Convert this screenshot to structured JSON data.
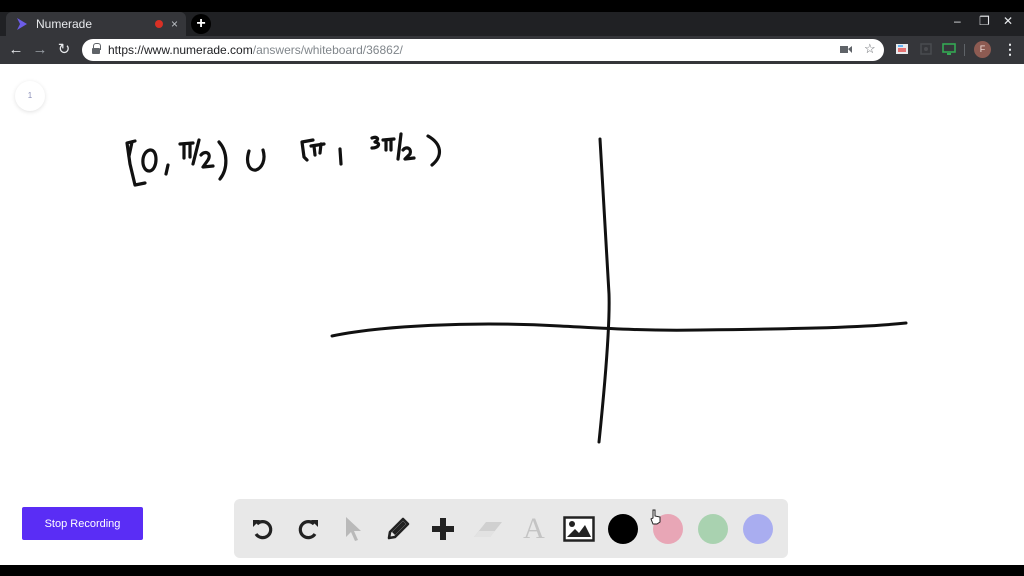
{
  "browser": {
    "tab": {
      "title": "Numerade",
      "favicon": "numerade-play-icon",
      "recording_indicator": "recording-dot-icon",
      "close": "×"
    },
    "new_tab": "+",
    "window_controls": {
      "minimize": "–",
      "restore": "❐",
      "close": "✕"
    },
    "nav": {
      "back": "←",
      "forward": "→",
      "reload": "↻"
    },
    "url": {
      "host": "https://www.numerade.com",
      "path": "/answers/whiteboard/36862/"
    },
    "omnibox_icons": [
      "camera-icon",
      "star-icon"
    ],
    "extensions": [
      "extension-icon",
      "extension-dim-icon",
      "cast-icon"
    ],
    "profile_initial": "F",
    "menu": "⋮"
  },
  "whiteboard": {
    "page_number": "1",
    "handwritten_text": "[0, π/2) ∪ [π, 3π/2)",
    "stop_button_label": "Stop Recording",
    "tools": [
      {
        "name": "undo",
        "icon": "undo-icon",
        "enabled": true
      },
      {
        "name": "redo",
        "icon": "redo-icon",
        "enabled": true
      },
      {
        "name": "select",
        "icon": "pointer-icon",
        "enabled": false
      },
      {
        "name": "pen",
        "icon": "pencil-icon",
        "enabled": true
      },
      {
        "name": "add",
        "icon": "plus-icon",
        "enabled": true
      },
      {
        "name": "eraser",
        "icon": "eraser-icon",
        "enabled": false
      },
      {
        "name": "text",
        "icon": "text-icon",
        "label": "A",
        "enabled": false
      },
      {
        "name": "image",
        "icon": "image-icon",
        "enabled": true
      }
    ],
    "colors": [
      {
        "name": "black",
        "hex": "#000000",
        "selected": true
      },
      {
        "name": "pink",
        "hex": "#e8a6b6",
        "selected": false
      },
      {
        "name": "green",
        "hex": "#a9d2b0",
        "selected": false
      },
      {
        "name": "blue",
        "hex": "#a9adf0",
        "selected": false
      }
    ],
    "accent": "#5a2df5"
  }
}
